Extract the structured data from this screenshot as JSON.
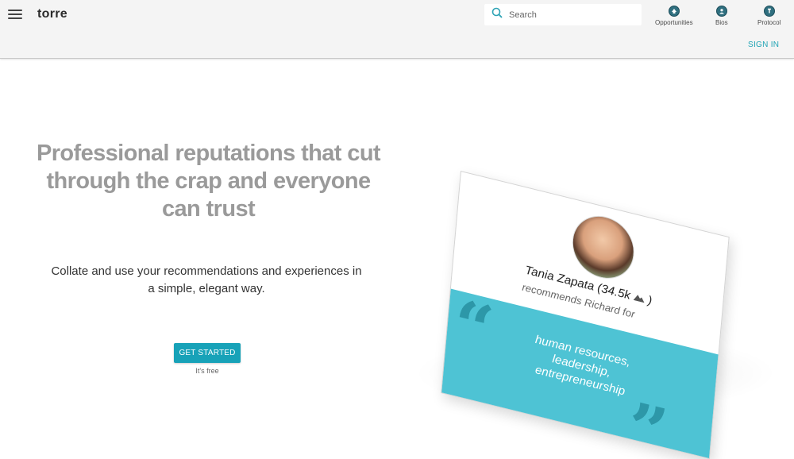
{
  "header": {
    "brand": "torre",
    "search": {
      "placeholder": "Search"
    },
    "nav": [
      {
        "label": "Opportunities",
        "icon": "opportunities-icon"
      },
      {
        "label": "Bios",
        "icon": "bios-icon"
      },
      {
        "label": "Protocol",
        "icon": "protocol-icon"
      }
    ],
    "sign_in": "SIGN IN"
  },
  "hero": {
    "title": "Professional reputations that cut through the crap and everyone can trust",
    "subtitle": "Collate and use your recommendations and experiences in a simple, elegant way.",
    "cta_label": "GET STARTED",
    "cta_note": "It's free"
  },
  "card": {
    "name": "Tania Zapata (34.5k",
    "name_suffix": ")",
    "recommends": "recommends Richard for",
    "skills": [
      "human resources,",
      "leadership,",
      "entrepreneurship"
    ],
    "quote_open": "“",
    "quote_close": "”"
  },
  "colors": {
    "accent": "#17a2b8",
    "card_band": "#4ec3d4",
    "title_gray": "#9a9a9a"
  }
}
